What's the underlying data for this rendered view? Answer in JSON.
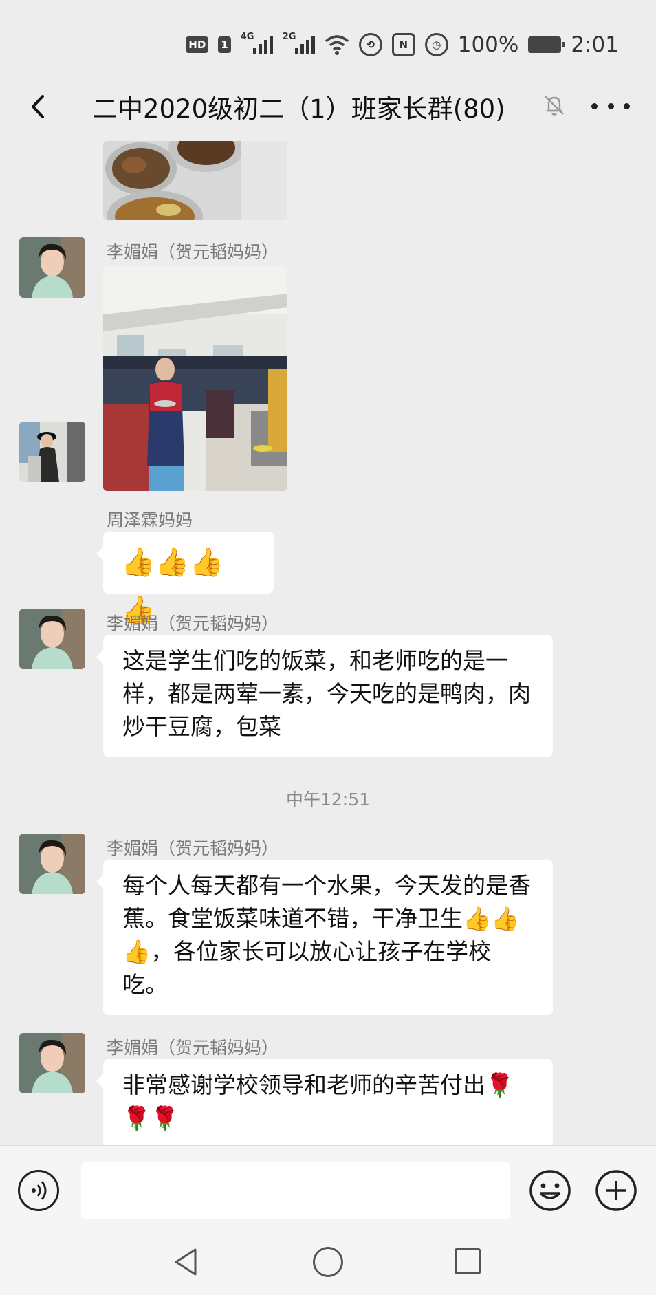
{
  "status_bar": {
    "hd_label": "HD",
    "hd_sim": "1",
    "signal1_label": "4G",
    "signal2_label": "2G",
    "nfc_label": "N",
    "battery_pct": "100%",
    "time": "2:01"
  },
  "header": {
    "title": "二中2020级初二（1）班家长群(80)"
  },
  "messages": [
    {
      "sender": "李媚娟（贺元韬妈妈）"
    },
    {
      "sender": "周泽霖妈妈",
      "text": "👍👍👍👍"
    },
    {
      "sender": "李媚娟（贺元韬妈妈）",
      "text": "这是学生们吃的饭菜，和老师吃的是一样，都是两荤一素，今天吃的是鸭肉，肉炒干豆腐，包菜"
    },
    {
      "sender": "李媚娟（贺元韬妈妈）",
      "text": "每个人每天都有一个水果，今天发的是香蕉。食堂饭菜味道不错，干净卫生👍👍👍，各位家长可以放心让孩子在学校吃。"
    },
    {
      "sender": "李媚娟（贺元韬妈妈）",
      "text": "非常感谢学校领导和老师的辛苦付出🌹🌹🌹"
    }
  ],
  "time_separator": "中午12:51",
  "input": {
    "value": "",
    "placeholder": ""
  },
  "icons": {
    "back": "back-arrow-icon",
    "mute": "mute-bell-icon",
    "more": "more-dots-icon",
    "voice": "voice-icon",
    "emoji": "emoji-icon",
    "plus": "plus-icon"
  },
  "colors": {
    "background": "#ededed",
    "bubble": "#ffffff",
    "sender_name": "#7a7a7a",
    "like_emoji": "#f5b11e"
  }
}
